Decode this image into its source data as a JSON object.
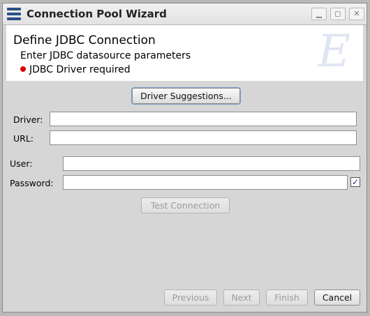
{
  "window": {
    "title": "Connection Pool Wizard"
  },
  "header": {
    "title": "Define JDBC Connection",
    "subtitle": "Enter JDBC datasource parameters",
    "warning": "JDBC Driver required",
    "watermark": "E"
  },
  "form": {
    "driver_suggestions_label": "Driver Suggestions...",
    "driver_label": "Driver:",
    "driver_value": "",
    "url_label": "URL:",
    "url_value": "",
    "user_label": "User:",
    "user_value": "",
    "password_label": "Password:",
    "password_value": "",
    "password_checkbox_checked": true,
    "password_checkbox_glyph": "✓",
    "test_connection_label": "Test Connection"
  },
  "footer": {
    "previous_label": "Previous",
    "next_label": "Next",
    "finish_label": "Finish",
    "cancel_label": "Cancel"
  },
  "colors": {
    "warning_dot": "#e00000",
    "window_bg": "#d6d6d6",
    "header_bg": "#ffffff"
  },
  "icons": [
    "app-menu-icon",
    "minimize-icon",
    "maximize-icon",
    "close-icon",
    "warning-dot-icon",
    "check-icon"
  ]
}
